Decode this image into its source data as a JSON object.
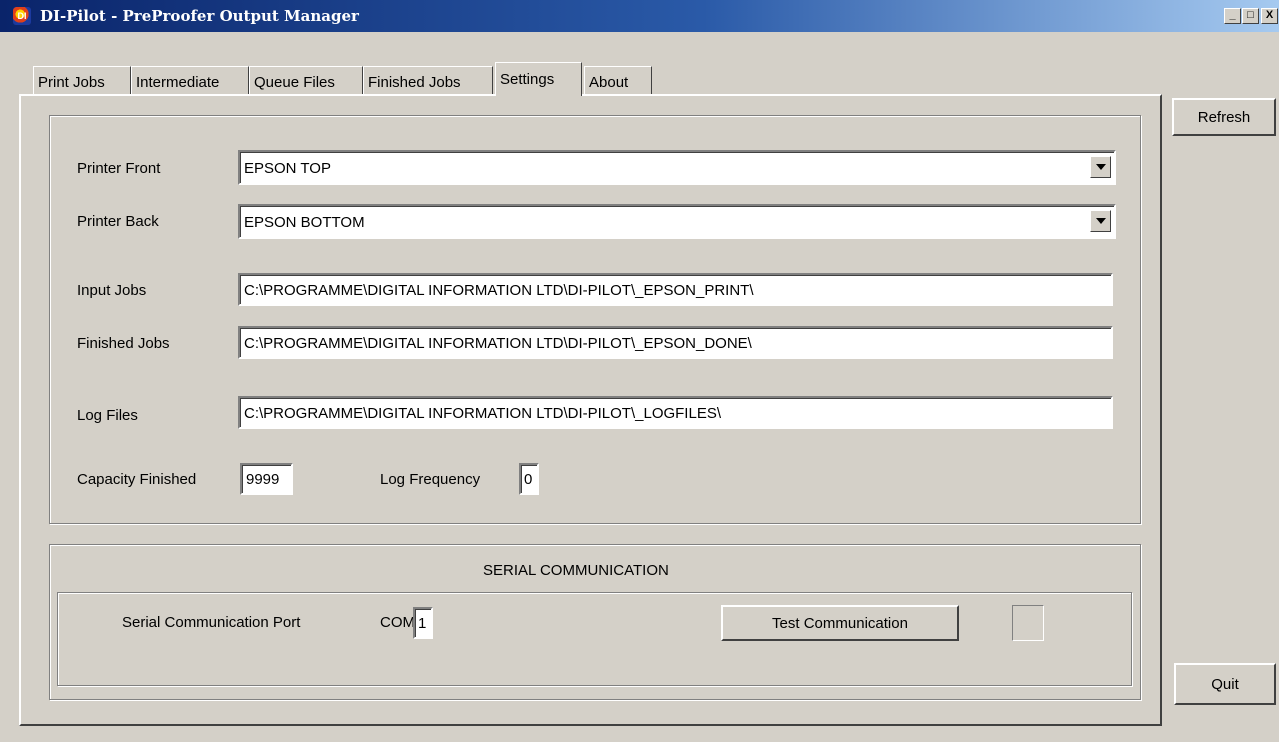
{
  "window": {
    "title": "DI-Pilot - PreProofer Output Manager",
    "icon": "app-logo-icon",
    "minimize": "_",
    "maximize": "□",
    "close": "X"
  },
  "tabs": [
    {
      "label": "Print Jobs"
    },
    {
      "label": "Intermediate"
    },
    {
      "label": "Queue Files"
    },
    {
      "label": "Finished Jobs"
    },
    {
      "label": "Settings",
      "active": true
    },
    {
      "label": "About"
    }
  ],
  "settings": {
    "printer_front": {
      "label": "Printer Front",
      "value": "EPSON TOP"
    },
    "printer_back": {
      "label": "Printer Back",
      "value": "EPSON BOTTOM"
    },
    "input_jobs": {
      "label": "Input Jobs",
      "value": "C:\\PROGRAMME\\DIGITAL INFORMATION LTD\\DI-PILOT\\_EPSON_PRINT\\"
    },
    "finished_jobs": {
      "label": "Finished Jobs",
      "value": "C:\\PROGRAMME\\DIGITAL INFORMATION LTD\\DI-PILOT\\_EPSON_DONE\\"
    },
    "log_files": {
      "label": "Log Files",
      "value": "C:\\PROGRAMME\\DIGITAL INFORMATION LTD\\DI-PILOT\\_LOGFILES\\"
    },
    "capacity_finished": {
      "label": "Capacity Finished",
      "value": "9999"
    },
    "log_frequency": {
      "label": "Log Frequency",
      "value": "0"
    }
  },
  "serial": {
    "heading": "SERIAL COMMUNICATION",
    "port_label": "Serial Communication Port",
    "com_label": "COM",
    "com_value": "1",
    "test_button": "Test Communication"
  },
  "side_buttons": {
    "refresh": "Refresh",
    "quit": "Quit"
  }
}
